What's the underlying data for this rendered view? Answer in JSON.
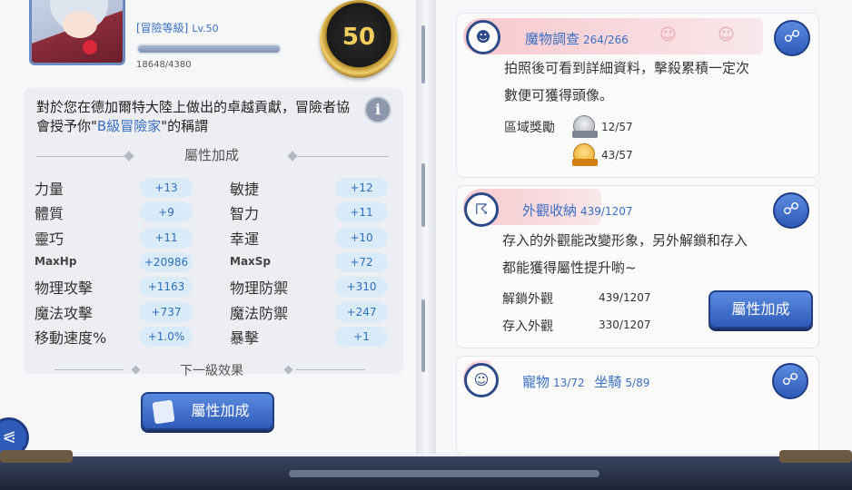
{
  "profile": {
    "rank_title": "[冒險等級]",
    "level": "Lv.50",
    "exp_progress": 1.0,
    "exp_text": "18648/4380",
    "medal_level": "50"
  },
  "description": {
    "text_before": "對於您在德加爾特大陸上做出的卓越貢獻，冒險者協會授予你\"",
    "highlight": "B級冒險家",
    "text_after": "\"的稱謂"
  },
  "attributes": {
    "section_title": "屬性加成",
    "rows": [
      {
        "left_label": "力量",
        "left_value": "+13",
        "right_label": "敏捷",
        "right_value": "+12"
      },
      {
        "left_label": "體質",
        "left_value": "+9",
        "right_label": "智力",
        "right_value": "+11"
      },
      {
        "left_label": "靈巧",
        "left_value": "+11",
        "right_label": "幸運",
        "right_value": "+10"
      },
      {
        "left_label": "MaxHp",
        "left_value": "+20986",
        "right_label": "MaxSp",
        "right_value": "+72"
      },
      {
        "left_label": "物理攻擊",
        "left_value": "+1163",
        "right_label": "物理防禦",
        "right_value": "+310"
      },
      {
        "left_label": "魔法攻擊",
        "left_value": "+737",
        "right_label": "魔法防禦",
        "right_value": "+247"
      },
      {
        "left_label": "移動速度%",
        "left_value": "+1.0%",
        "right_label": "暴擊",
        "right_value": "+1"
      }
    ],
    "next_level_title": "下一級效果",
    "button_label": "屬性加成"
  },
  "monster_card": {
    "title": "魔物調查",
    "count": "264/266",
    "text_line1": "拍照後可看到詳細資料，擊殺累積一定次",
    "text_line2": "數便可獲得頭像。",
    "reward_label": "區域獎勵",
    "silver_value": "12/57",
    "gold_value": "43/57"
  },
  "appearance_card": {
    "title": "外觀收納",
    "count": "439/1207",
    "text_line1": "存入的外觀能改變形象，另外解鎖和存入",
    "text_line2": "都能獲得屬性提升喲~",
    "unlock_label": "解鎖外觀",
    "unlock_value": "439/1207",
    "stored_label": "存入外觀",
    "stored_value": "330/1207",
    "button_label": "屬性加成"
  },
  "pet_card": {
    "title_pet": "寵物",
    "pet_count": "13/72",
    "title_mount": "坐騎",
    "mount_count": "5/89"
  },
  "colors": {
    "accent_blue": "#3b6fc4",
    "button_blue": "#2f5bb8",
    "pill_bg": "#d9ebf8",
    "card_header_pink": "#f7c9cf"
  }
}
